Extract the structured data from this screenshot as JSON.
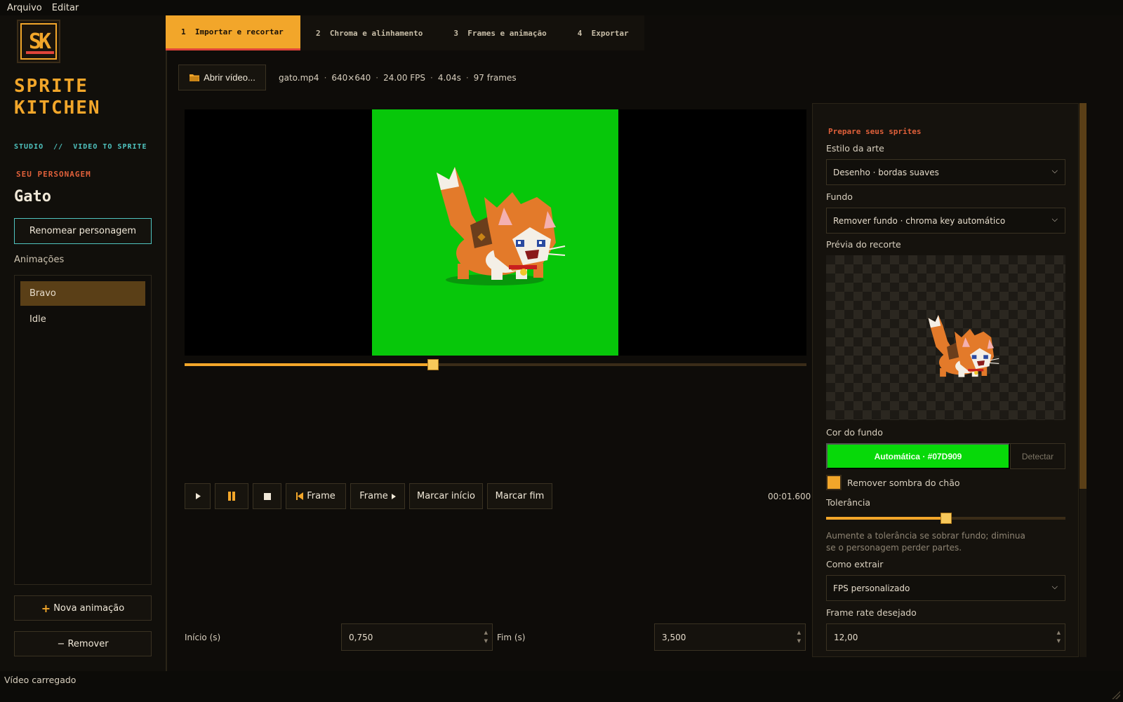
{
  "menu": {
    "items": [
      "Arquivo",
      "Editar"
    ]
  },
  "sidebar": {
    "logo_letters": "SK",
    "brand_line1": "SPRITE",
    "brand_line2": "KITCHEN",
    "tagline": "STUDIO  //  VIDEO TO SPRITE",
    "character_heading": "SEU PERSONAGEM",
    "character_name": "Gato",
    "rename_label": "Renomear personagem",
    "animations_label": "Animações",
    "animations": [
      {
        "label": "Bravo",
        "selected": true
      },
      {
        "label": "Idle",
        "selected": false
      }
    ],
    "new_animation_label": "Nova animação",
    "remove_label": "− Remover"
  },
  "tabs": [
    {
      "number": "1",
      "label": "Importar e recortar",
      "active": true
    },
    {
      "number": "2",
      "label": "Chroma e alinhamento",
      "active": false
    },
    {
      "number": "3",
      "label": "Frames e animação",
      "active": false
    },
    {
      "number": "4",
      "label": "Exportar",
      "active": false
    }
  ],
  "file": {
    "open_label": "Abrir vídeo...",
    "name": "gato.mp4",
    "resolution": "640×640",
    "fps": "24.00 FPS",
    "duration": "4.04s",
    "frames": "97 frames"
  },
  "player": {
    "chroma_color": "#07C70A",
    "seek_fraction": 0.4,
    "prev_frame_label": "Frame",
    "next_frame_label": "Frame",
    "mark_start_label": "Marcar início",
    "mark_end_label": "Marcar fim",
    "timecode": "00:01.600"
  },
  "range": {
    "start_label": "Início (s)",
    "start_value": "0,750",
    "end_label": "Fim (s)",
    "end_value": "3,500"
  },
  "panel": {
    "title": "Prepare seus sprites",
    "art_style_label": "Estilo da arte",
    "art_style_value": "Desenho · bordas suaves",
    "background_label": "Fundo",
    "background_value": "Remover fundo · chroma key automático",
    "preview_label": "Prévia do recorte",
    "bg_color_label": "Cor do fundo",
    "bg_color_value": "Automática · #07D909",
    "bg_color_hex": "#07D909",
    "detect_label": "Detectar",
    "remove_shadow_label": "Remover sombra do chão",
    "remove_shadow_checked": true,
    "tolerance_label": "Tolerância",
    "tolerance_fraction": 0.5,
    "tolerance_help": "Aumente a tolerância se sobrar fundo; diminua se o personagem perder partes.",
    "extract_label": "Como extrair",
    "extract_value": "FPS personalizado",
    "framerate_label": "Frame rate desejado",
    "framerate_value": "12,00"
  },
  "status": {
    "text": "Vídeo carregado"
  }
}
